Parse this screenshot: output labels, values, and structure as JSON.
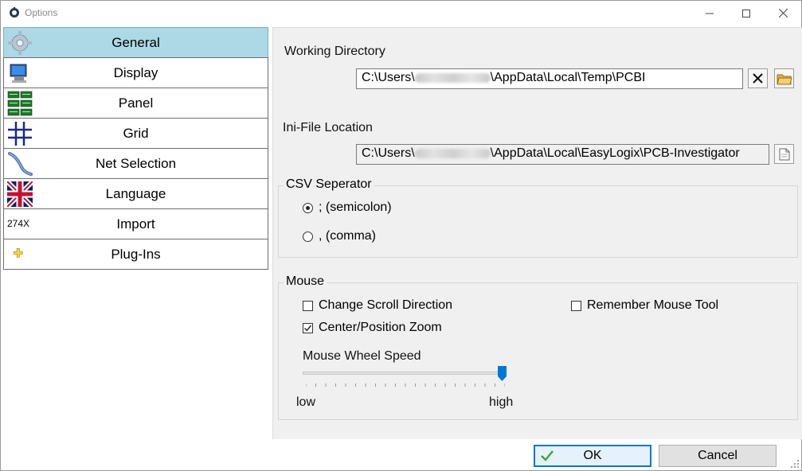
{
  "window": {
    "title": "Options"
  },
  "nav": {
    "items": [
      {
        "label": "General",
        "icon": "gear-icon"
      },
      {
        "label": "Display",
        "icon": "monitor-icon"
      },
      {
        "label": "Panel",
        "icon": "panel-icon"
      },
      {
        "label": "Grid",
        "icon": "grid-icon"
      },
      {
        "label": "Net Selection",
        "icon": "net-selection-icon"
      },
      {
        "label": "Language",
        "icon": "uk-flag-icon"
      },
      {
        "label": "Import",
        "icon": "import-icon",
        "icon_text": "274X"
      },
      {
        "label": "Plug-Ins",
        "icon": "plugin-icon"
      }
    ],
    "selected": "General"
  },
  "general": {
    "working_directory": {
      "label": "Working Directory",
      "path_prefix": "C:\\Users\\",
      "path_suffix": "\\AppData\\Local\\Temp\\PCBI"
    },
    "ini_file": {
      "label": "Ini-File Location",
      "path_prefix": "C:\\Users\\",
      "path_suffix": "\\AppData\\Local\\EasyLogix\\PCB-Investigator"
    },
    "csv": {
      "title": "CSV Seperator",
      "options": [
        {
          "label": "; (semicolon)",
          "selected": true
        },
        {
          "label": ", (comma)",
          "selected": false
        }
      ]
    },
    "mouse": {
      "title": "Mouse",
      "change_scroll_direction": {
        "label": "Change Scroll Direction",
        "checked": false
      },
      "remember_mouse_tool": {
        "label": "Remember Mouse Tool",
        "checked": false
      },
      "center_position_zoom": {
        "label": "Center/Position Zoom",
        "checked": true
      },
      "wheel_speed": {
        "label": "Mouse Wheel Speed",
        "low_label": "low",
        "high_label": "high",
        "value": 1.0
      }
    }
  },
  "footer": {
    "ok_label": "OK",
    "cancel_label": "Cancel"
  },
  "colors": {
    "nav_selected": "#add8e6",
    "accent": "#0078d7",
    "panel_bg": "#f0f0f0"
  }
}
